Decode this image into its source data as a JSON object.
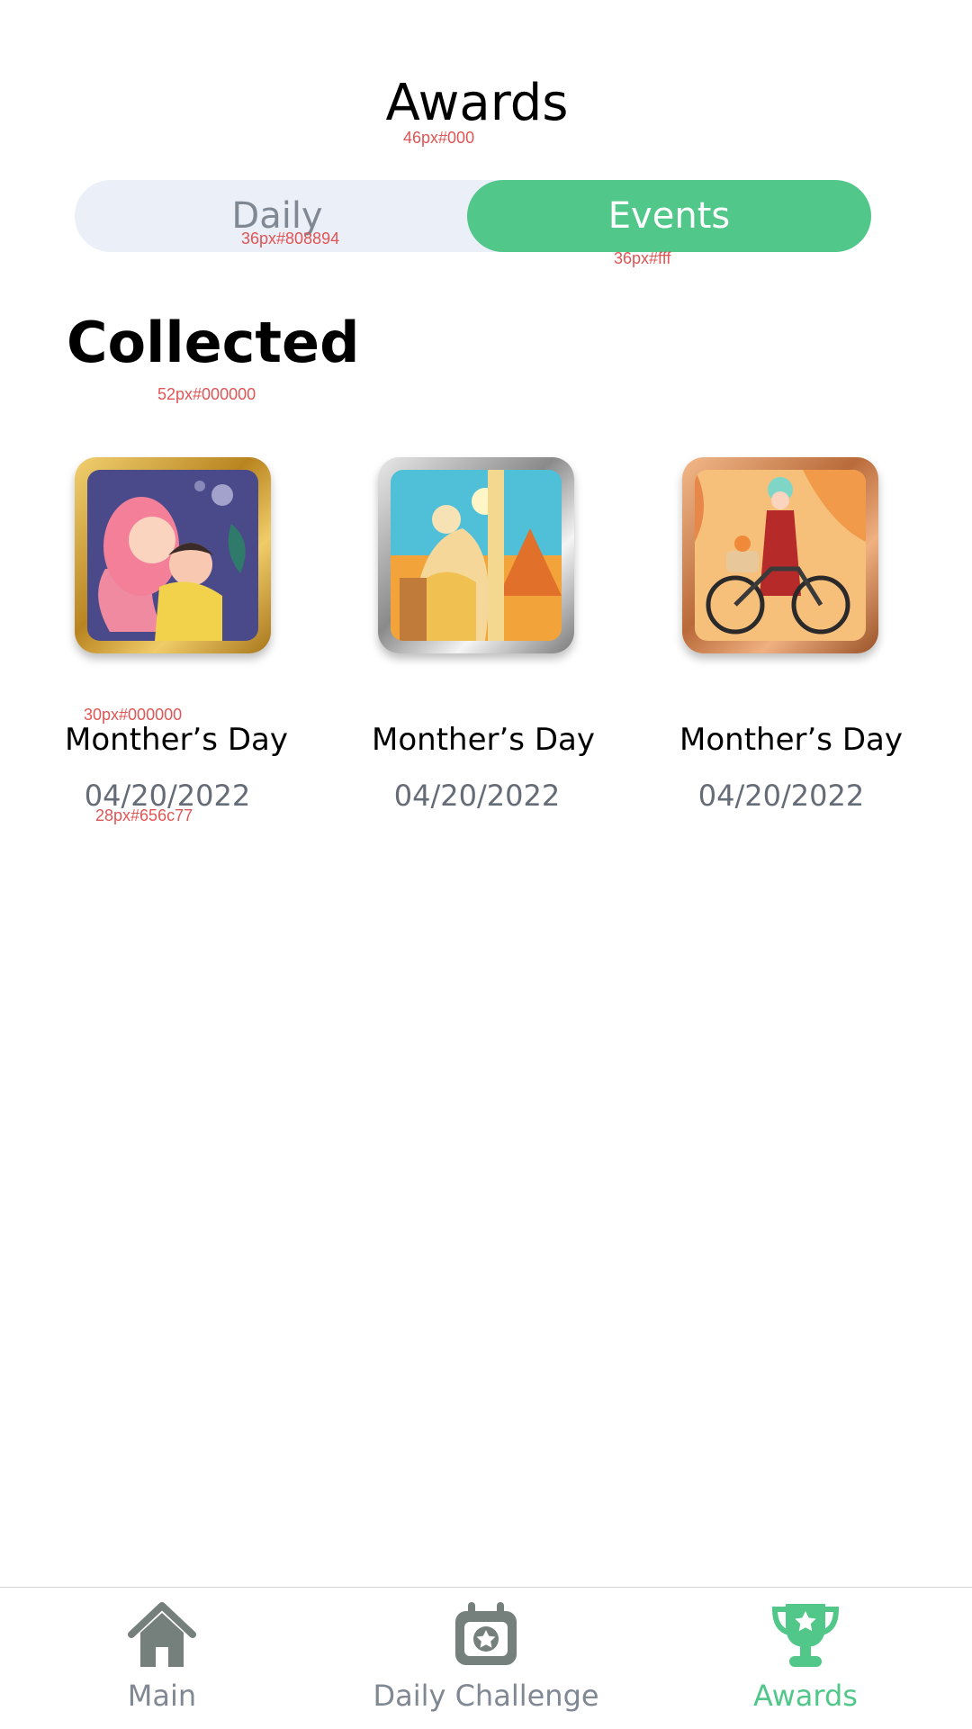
{
  "header": {
    "title": "Awards",
    "title_spec": "46px#000"
  },
  "segmented": {
    "daily_label": "Daily",
    "daily_spec": "36px#808894",
    "events_label": "Events",
    "events_spec": "36px#fff",
    "selected": "Events",
    "accent_color": "#52c78a"
  },
  "section": {
    "title": "Collected",
    "title_spec": "52px#000000"
  },
  "awards": [
    {
      "name": "Monther’s Day",
      "date": "04/20/2022",
      "frame": "gold"
    },
    {
      "name": "Monther’s Day",
      "date": "04/20/2022",
      "frame": "silver"
    },
    {
      "name": "Monther’s Day",
      "date": "04/20/2022",
      "frame": "bronze"
    }
  ],
  "award_specs": {
    "name_spec": "30px#000000",
    "date_spec": "28px#656c77"
  },
  "tabbar": {
    "items": [
      {
        "label": "Main",
        "icon": "home-icon",
        "active": false
      },
      {
        "label": "Daily Challenge",
        "icon": "calendar-star-icon",
        "active": false
      },
      {
        "label": "Awards",
        "icon": "trophy-icon",
        "active": true
      }
    ],
    "inactive_color": "#808894",
    "active_color": "#52c78a"
  }
}
